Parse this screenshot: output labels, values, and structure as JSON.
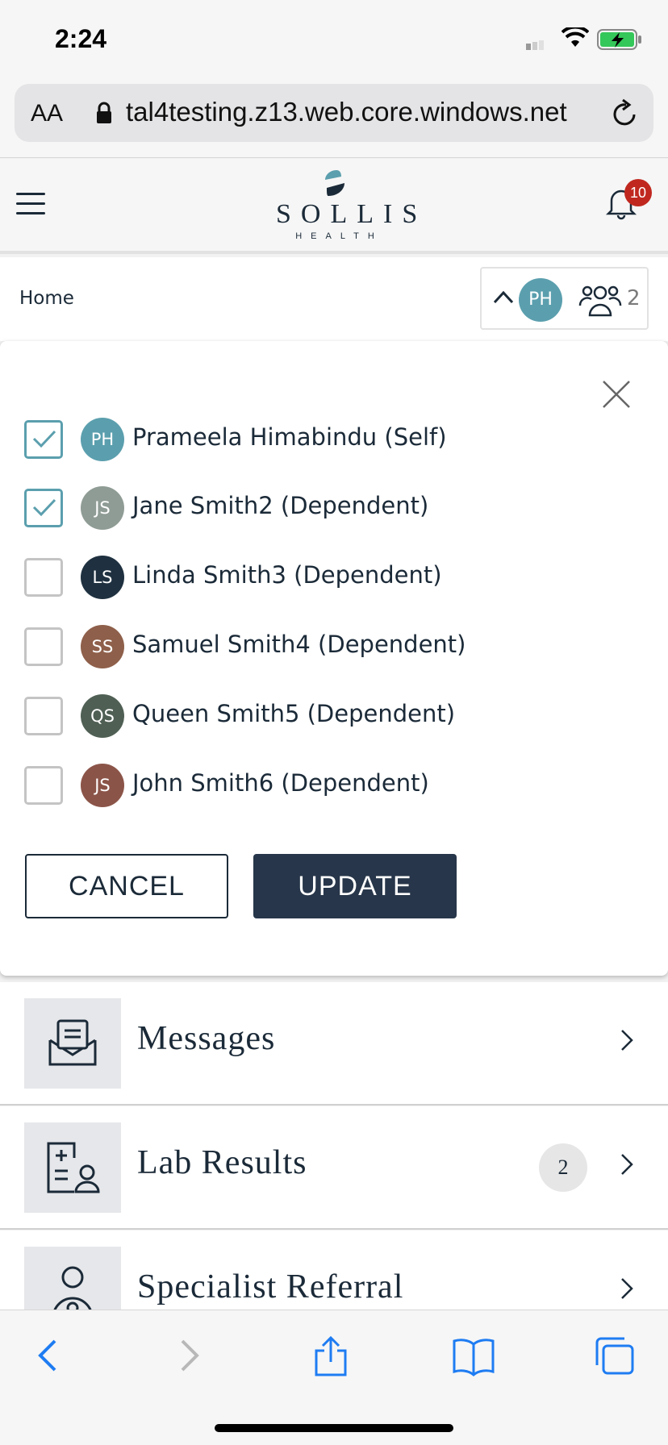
{
  "status_bar": {
    "time": "2:24"
  },
  "browser": {
    "font_size_button": "AA",
    "url": "tal4testing.z13.web.core.windows.net"
  },
  "header": {
    "logo_name": "SOLLIS",
    "logo_sub": "HEALTH",
    "notification_count": "10"
  },
  "breadcrumb": "Home",
  "selector": {
    "avatar_initials": "PH",
    "member_count": "2"
  },
  "dialog": {
    "members": [
      {
        "initials": "PH",
        "name": "Prameela Himabindu (Self)",
        "checked": true,
        "color": "#5b9fae"
      },
      {
        "initials": "JS",
        "name": "Jane Smith2 (Dependent)",
        "checked": true,
        "color": "#8f9c95"
      },
      {
        "initials": "LS",
        "name": "Linda Smith3 (Dependent)",
        "checked": false,
        "color": "#1f3140"
      },
      {
        "initials": "SS",
        "name": "Samuel Smith4 (Dependent)",
        "checked": false,
        "color": "#8e5f4a"
      },
      {
        "initials": "QS",
        "name": "Queen Smith5 (Dependent)",
        "checked": false,
        "color": "#4f5f54"
      },
      {
        "initials": "JS",
        "name": "John Smith6 (Dependent)",
        "checked": false,
        "color": "#8b5448"
      }
    ],
    "cancel_label": "CANCEL",
    "update_label": "UPDATE"
  },
  "menu": [
    {
      "label": "Messages",
      "icon": "messages-icon"
    },
    {
      "label": "Lab Results",
      "icon": "lab-results-icon",
      "badge": "2"
    },
    {
      "label": "Specialist Referral",
      "icon": "doctor-icon"
    }
  ],
  "colors": {
    "accent": "#5b9fae",
    "primary": "#27364a",
    "badge": "#c0281f"
  }
}
